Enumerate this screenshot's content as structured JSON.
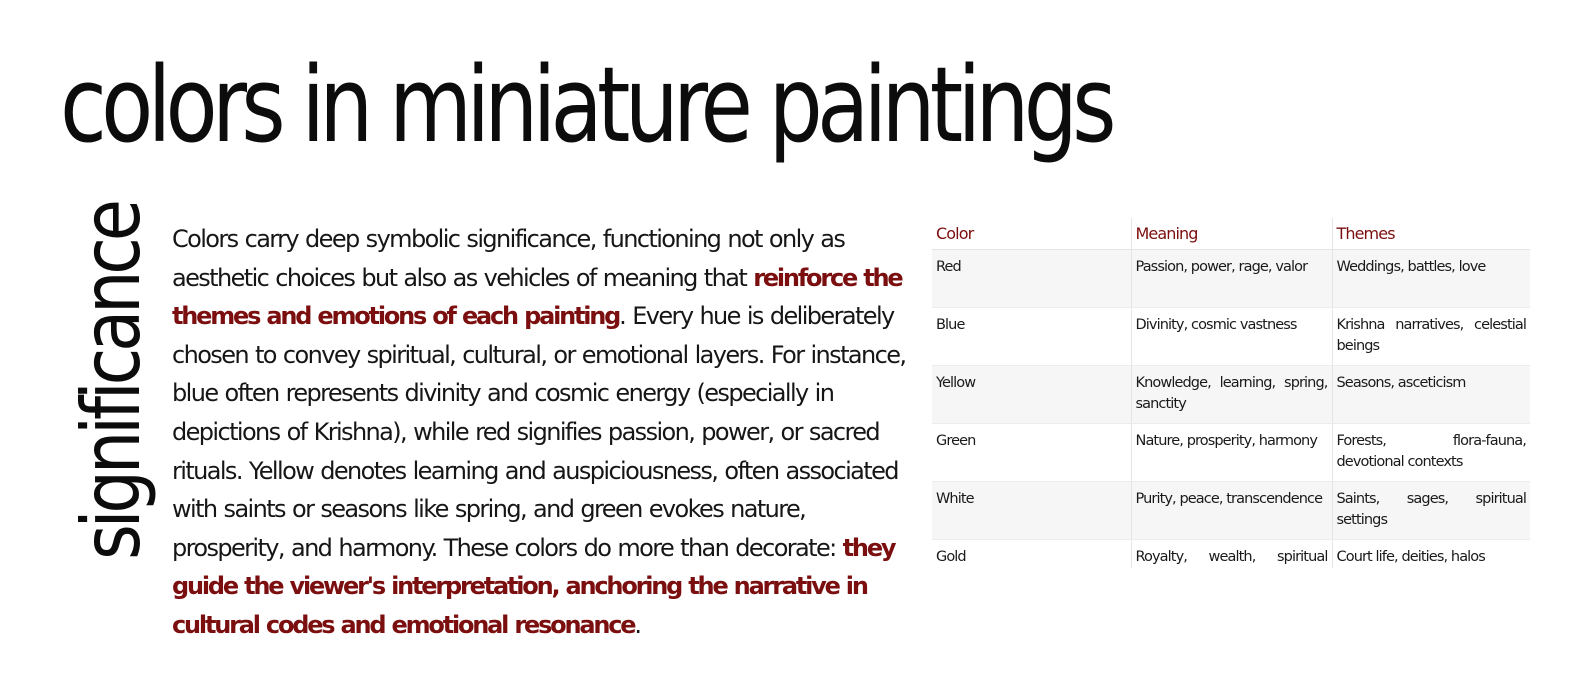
{
  "title": "colors in miniature paintings",
  "side_label": "significance",
  "paragraph": {
    "p1": "Colors carry deep symbolic significance, functioning not only as aesthetic choices but also as vehicles of meaning that ",
    "h1": "reinforce the themes and emotions of each painting",
    "p2": ". Every hue is deliberately chosen to convey spiritual, cultural, or emotional layers. For instance, blue often represents divinity and cosmic energy (especially in depictions of Krishna), while red signifies passion, power, or sacred rituals. Yellow denotes learning and auspiciousness, often associated with saints or seasons like spring, and green evokes nature, prosperity, and harmony. These colors do more than decorate: ",
    "h2": "they guide the viewer's interpretation, anchoring the narrative in cultural codes and emotional resonance",
    "p3": "."
  },
  "table": {
    "headers": [
      "Color",
      "Meaning",
      "Themes"
    ],
    "rows": [
      [
        "Red",
        "Passion, power, rage, valor",
        "Weddings, battles, love"
      ],
      [
        "Blue",
        "Divinity, cosmic vastness",
        "Krishna narratives, celestial beings"
      ],
      [
        "Yellow",
        "Knowledge, learning, spring, sanctity",
        "Seasons, asceticism"
      ],
      [
        "Green",
        "Nature, prosperity, harmony",
        "Forests, flora-fauna, devotional contexts"
      ],
      [
        "White",
        "Purity, peace, transcendence",
        "Saints, sages, spiritual settings"
      ],
      [
        "Gold",
        "Royalty, wealth, spiritual elevation",
        "Court life, deities, halos"
      ]
    ]
  },
  "colors": {
    "accent": "#7b0e0e",
    "text": "#111111",
    "row_shade": "#f6f6f6",
    "background": "#ffffff"
  }
}
